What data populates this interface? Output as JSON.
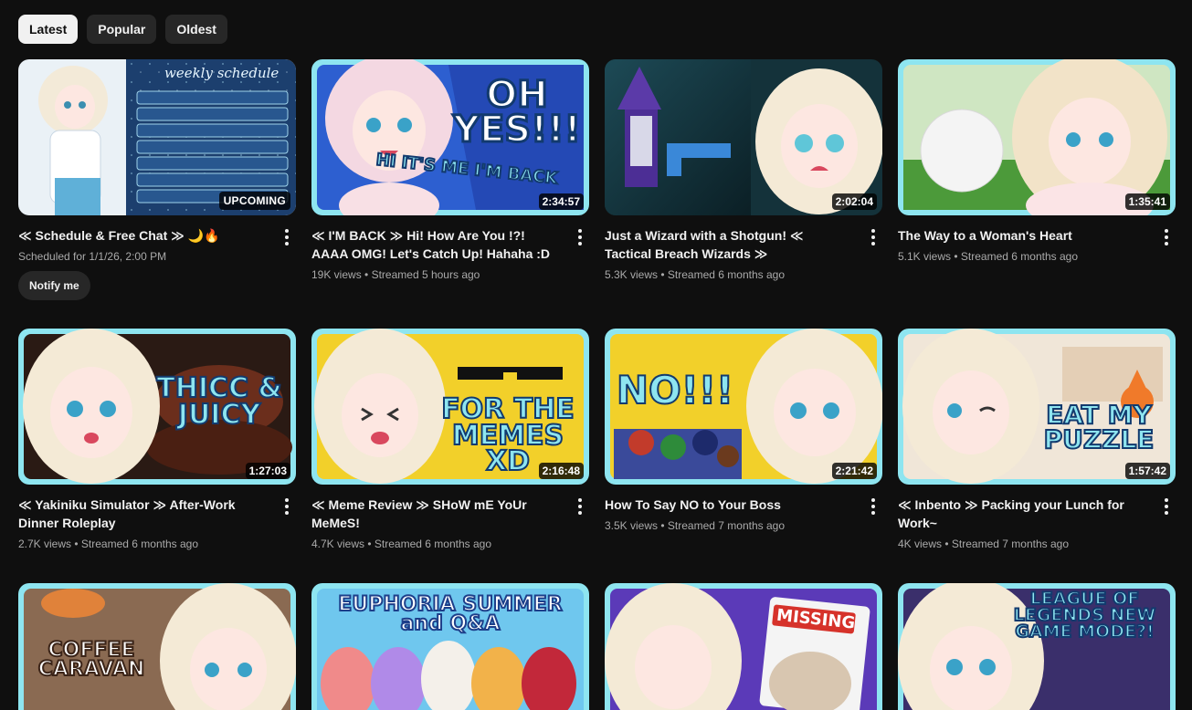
{
  "filters": [
    {
      "label": "Latest",
      "active": true
    },
    {
      "label": "Popular",
      "active": false
    },
    {
      "label": "Oldest",
      "active": false
    }
  ],
  "videos": [
    {
      "title": "≪ Schedule & Free Chat ≫ 🌙🔥",
      "sub": "Scheduled for 1/1/26, 2:00 PM",
      "badge": "UPCOMING",
      "notify": "Notify me",
      "thumb_text": "weekly schedule"
    },
    {
      "title": "≪ I'M BACK ≫ Hi! How Are You !?! AAAA OMG! Let's Catch Up! Hahaha :D",
      "views": "19K views",
      "age": "Streamed 5 hours ago",
      "duration": "2:34:57",
      "thumb_text": "OH YES!!! HI IT'S ME I'M BACK"
    },
    {
      "title": "Just a Wizard with a Shotgun! ≪ Tactical Breach Wizards ≫",
      "views": "5.3K views",
      "age": "Streamed 6 months ago",
      "duration": "2:02:04"
    },
    {
      "title": "The Way to a Woman's Heart",
      "views": "5.1K views",
      "age": "Streamed 6 months ago",
      "duration": "1:35:41"
    },
    {
      "title": "≪ Yakiniku Simulator ≫ After-Work Dinner Roleplay",
      "views": "2.7K views",
      "age": "Streamed 6 months ago",
      "duration": "1:27:03",
      "thumb_text": "THICC & JUICY"
    },
    {
      "title": "≪ Meme Review ≫ SHoW mE YoUr MeMeS!",
      "views": "4.7K views",
      "age": "Streamed 6 months ago",
      "duration": "2:16:48",
      "thumb_text": "FOR THE MEMES XD"
    },
    {
      "title": "How To Say NO to Your Boss",
      "views": "3.5K views",
      "age": "Streamed 7 months ago",
      "duration": "2:21:42",
      "thumb_text": "NO!!!"
    },
    {
      "title": "≪ Inbento ≫ Packing your Lunch for Work~",
      "views": "4K views",
      "age": "Streamed 7 months ago",
      "duration": "1:57:42",
      "thumb_text": "EAT MY PUZZLE"
    },
    {
      "thumb_text": "COFFEE CARAVAN"
    },
    {
      "thumb_text": "EUPHORIA SUMMER and Q&A"
    },
    {
      "thumb_text": "MISSING"
    },
    {
      "thumb_text": "LEAGUE OF LEGENDS NEW GAME MODE?!"
    }
  ],
  "dot_separator": "•",
  "colors": {
    "background": "#0f0f0f",
    "chip": "#272727",
    "chip_active": "#f1f1f1",
    "accent_frame": "#8ee5f0"
  }
}
